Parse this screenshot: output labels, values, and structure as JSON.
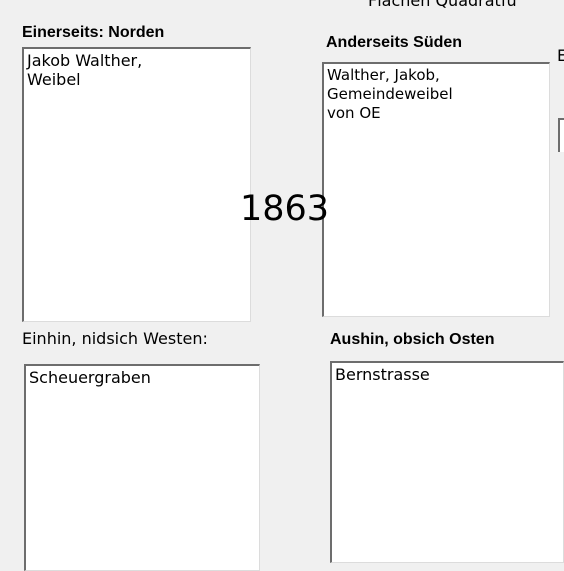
{
  "top_header_partial": "Flächen Quadratfu",
  "year_overlay": "1863",
  "right_edge_partial_label": "E",
  "fields": {
    "north": {
      "label": "Einerseits: Norden",
      "value": "Jakob Walther,\nWeibel"
    },
    "south": {
      "label": "Anderseits Süden",
      "value": "Walther, Jakob,\nGemeindeweibel\nvon OE"
    },
    "west": {
      "label": "Einhin, nidsich Westen:",
      "value": "Scheuergraben"
    },
    "east": {
      "label": "Aushin,  obsich Osten",
      "value": "Bernstrasse"
    }
  }
}
